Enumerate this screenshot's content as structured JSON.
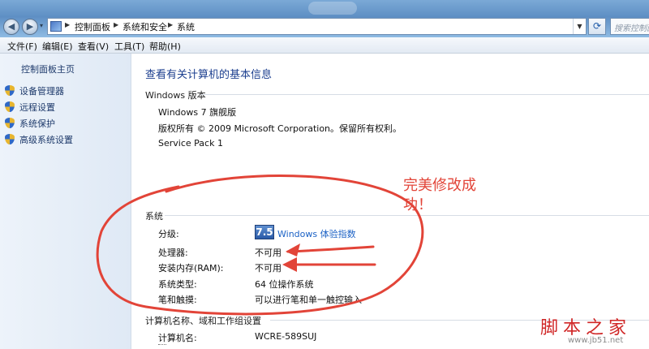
{
  "window": {
    "title_glow": "",
    "breadcrumb": [
      "控制面板",
      "系统和安全",
      "系统"
    ],
    "search_placeholder": "搜索控制面板"
  },
  "menu": [
    {
      "label": "文件(F)"
    },
    {
      "label": "编辑(E)"
    },
    {
      "label": "查看(V)"
    },
    {
      "label": "工具(T)"
    },
    {
      "label": "帮助(H)"
    }
  ],
  "sidebar": {
    "home": "控制面板主页",
    "tasks": [
      {
        "label": "设备管理器",
        "icon": "shield-icon"
      },
      {
        "label": "远程设置",
        "icon": "shield-icon"
      },
      {
        "label": "系统保护",
        "icon": "shield-icon"
      },
      {
        "label": "高级系统设置",
        "icon": "shield-icon"
      }
    ]
  },
  "main": {
    "title": "查看有关计算机的基本信息",
    "edition": {
      "heading": "Windows 版本",
      "name": "Windows 7 旗舰版",
      "copyright": "版权所有 © 2009 Microsoft Corporation。保留所有权利。",
      "service_pack": "Service Pack 1"
    },
    "system": {
      "heading": "系统",
      "rating_label": "分级:",
      "rating_score": "7.5",
      "rating_link": "Windows 体验指数",
      "rows": [
        {
          "label": "处理器:",
          "value": "不可用"
        },
        {
          "label": "安装内存(RAM):",
          "value": "不可用"
        },
        {
          "label": "系统类型:",
          "value": "64 位操作系统"
        },
        {
          "label": "笔和触摸:",
          "value": "可以进行笔和单一触控输入"
        }
      ]
    },
    "computer": {
      "heading": "计算机名称、域和工作组设置",
      "name_label": "计算机名:",
      "name_value": "WCRE-589SUJ"
    }
  },
  "annotation": {
    "line1": "完美修改成",
    "line2": "功！",
    "color": "#e24438"
  },
  "watermark": {
    "main": "脚本之家",
    "url": "www.jb51.net"
  }
}
